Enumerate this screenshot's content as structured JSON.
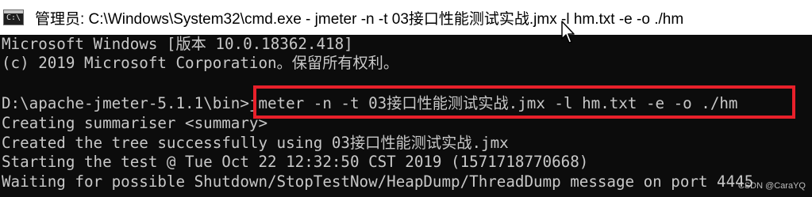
{
  "window": {
    "title": "管理员: C:\\Windows\\System32\\cmd.exe - jmeter  -n -t 03接口性能测试实战.jmx -l hm.txt -e -o ./hm",
    "icon": "cmd-icon"
  },
  "console": {
    "lines": [
      "Microsoft Windows [版本 10.0.18362.418]",
      "(c) 2019 Microsoft Corporation。保留所有权利。",
      "",
      "D:\\apache-jmeter-5.1.1\\bin>jmeter -n -t 03接口性能测试实战.jmx -l hm.txt -e -o ./hm",
      "Creating summariser <summary>",
      "Created the tree successfully using 03接口性能测试实战.jmx",
      "Starting the test @ Tue Oct 22 12:32:50 CST 2019 (1571718770668)",
      "Waiting for possible Shutdown/StopTestNow/HeapDump/ThreadDump message on port 4445"
    ]
  },
  "highlight": {
    "color": "#e8202a"
  },
  "watermark": {
    "text": "CSDN @CaraYQ"
  },
  "colors": {
    "console_bg": "#0c0c0c",
    "console_text": "#c8c8c8",
    "titlebar_bg": "#ffffff"
  }
}
